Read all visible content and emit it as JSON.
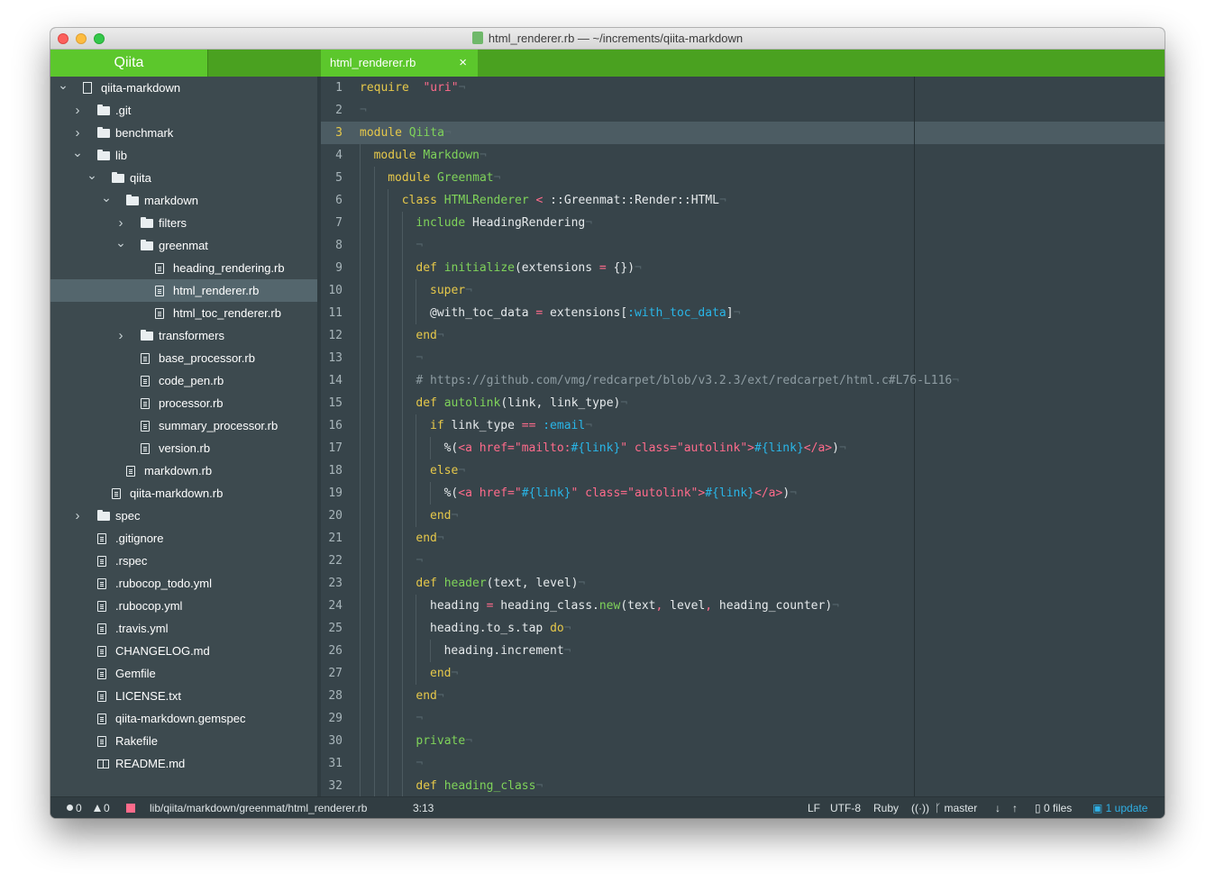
{
  "window": {
    "title": "html_renderer.rb — ~/increments/qiita-markdown"
  },
  "header": {
    "project_title": "Qiita",
    "active_tab": "html_renderer.rb",
    "tab_close": "×"
  },
  "sidebar": {
    "items": [
      {
        "label": "qiita-markdown",
        "type": "repo",
        "depth": 0,
        "chevron": "down"
      },
      {
        "label": ".git",
        "type": "folder",
        "depth": 1,
        "chevron": "right"
      },
      {
        "label": "benchmark",
        "type": "folder",
        "depth": 1,
        "chevron": "right"
      },
      {
        "label": "lib",
        "type": "folder",
        "depth": 1,
        "chevron": "down"
      },
      {
        "label": "qiita",
        "type": "folder",
        "depth": 2,
        "chevron": "down"
      },
      {
        "label": "markdown",
        "type": "folder",
        "depth": 3,
        "chevron": "down"
      },
      {
        "label": "filters",
        "type": "folder",
        "depth": 4,
        "chevron": "right"
      },
      {
        "label": "greenmat",
        "type": "folder",
        "depth": 4,
        "chevron": "down"
      },
      {
        "label": "heading_rendering.rb",
        "type": "file",
        "depth": 5,
        "chevron": ""
      },
      {
        "label": "html_renderer.rb",
        "type": "file",
        "depth": 5,
        "chevron": "",
        "selected": true
      },
      {
        "label": "html_toc_renderer.rb",
        "type": "file",
        "depth": 5,
        "chevron": ""
      },
      {
        "label": "transformers",
        "type": "folder",
        "depth": 4,
        "chevron": "right"
      },
      {
        "label": "base_processor.rb",
        "type": "file",
        "depth": 4,
        "chevron": ""
      },
      {
        "label": "code_pen.rb",
        "type": "file",
        "depth": 4,
        "chevron": ""
      },
      {
        "label": "processor.rb",
        "type": "file",
        "depth": 4,
        "chevron": ""
      },
      {
        "label": "summary_processor.rb",
        "type": "file",
        "depth": 4,
        "chevron": ""
      },
      {
        "label": "version.rb",
        "type": "file",
        "depth": 4,
        "chevron": ""
      },
      {
        "label": "markdown.rb",
        "type": "file",
        "depth": 3,
        "chevron": ""
      },
      {
        "label": "qiita-markdown.rb",
        "type": "file",
        "depth": 2,
        "chevron": ""
      },
      {
        "label": "spec",
        "type": "folder",
        "depth": 1,
        "chevron": "right"
      },
      {
        "label": ".gitignore",
        "type": "file",
        "depth": 1,
        "chevron": ""
      },
      {
        "label": ".rspec",
        "type": "file",
        "depth": 1,
        "chevron": ""
      },
      {
        "label": ".rubocop_todo.yml",
        "type": "file",
        "depth": 1,
        "chevron": ""
      },
      {
        "label": ".rubocop.yml",
        "type": "file",
        "depth": 1,
        "chevron": ""
      },
      {
        "label": ".travis.yml",
        "type": "file",
        "depth": 1,
        "chevron": ""
      },
      {
        "label": "CHANGELOG.md",
        "type": "file",
        "depth": 1,
        "chevron": ""
      },
      {
        "label": "Gemfile",
        "type": "file",
        "depth": 1,
        "chevron": ""
      },
      {
        "label": "LICENSE.txt",
        "type": "file",
        "depth": 1,
        "chevron": ""
      },
      {
        "label": "qiita-markdown.gemspec",
        "type": "file",
        "depth": 1,
        "chevron": ""
      },
      {
        "label": "Rakefile",
        "type": "file",
        "depth": 1,
        "chevron": ""
      },
      {
        "label": "README.md",
        "type": "book",
        "depth": 1,
        "chevron": ""
      }
    ]
  },
  "editor": {
    "cursor_line": 3,
    "lines": [
      {
        "n": "1",
        "indent": 0,
        "tokens": [
          [
            "kw",
            "require"
          ],
          [
            "",
            "  "
          ],
          [
            "str",
            "\"uri\""
          ]
        ]
      },
      {
        "n": "2",
        "indent": 0,
        "tokens": []
      },
      {
        "n": "3",
        "indent": 0,
        "tokens": [
          [
            "kw",
            "module"
          ],
          [
            "",
            " "
          ],
          [
            "cls",
            "Qiita"
          ]
        ]
      },
      {
        "n": "4",
        "indent": 1,
        "tokens": [
          [
            "kw",
            "module"
          ],
          [
            "",
            " "
          ],
          [
            "cls",
            "Markdown"
          ]
        ]
      },
      {
        "n": "5",
        "indent": 2,
        "tokens": [
          [
            "kw",
            "module"
          ],
          [
            "",
            " "
          ],
          [
            "cls",
            "Greenmat"
          ]
        ]
      },
      {
        "n": "6",
        "indent": 3,
        "tokens": [
          [
            "kw",
            "class"
          ],
          [
            "",
            " "
          ],
          [
            "cls",
            "HTMLRenderer"
          ],
          [
            "",
            " "
          ],
          [
            "op",
            "<"
          ],
          [
            "",
            " ::Greenmat::Render::HTML"
          ]
        ]
      },
      {
        "n": "7",
        "indent": 4,
        "tokens": [
          [
            "fn",
            "include"
          ],
          [
            "",
            " HeadingRendering"
          ]
        ]
      },
      {
        "n": "8",
        "indent": 4,
        "tokens": []
      },
      {
        "n": "9",
        "indent": 4,
        "tokens": [
          [
            "kw",
            "def"
          ],
          [
            "",
            " "
          ],
          [
            "fn",
            "initialize"
          ],
          [
            "",
            "(extensions "
          ],
          [
            "op",
            "="
          ],
          [
            "",
            " {})"
          ]
        ]
      },
      {
        "n": "10",
        "indent": 5,
        "tokens": [
          [
            "kw",
            "super"
          ]
        ]
      },
      {
        "n": "11",
        "indent": 5,
        "tokens": [
          [
            "",
            "@with_toc_data "
          ],
          [
            "op",
            "="
          ],
          [
            "",
            " extensions["
          ],
          [
            "sym",
            ":with_toc_data"
          ],
          [
            "",
            "]"
          ]
        ]
      },
      {
        "n": "12",
        "indent": 4,
        "tokens": [
          [
            "kw",
            "end"
          ]
        ]
      },
      {
        "n": "13",
        "indent": 4,
        "tokens": []
      },
      {
        "n": "14",
        "indent": 4,
        "tokens": [
          [
            "cmt",
            "# https://github.com/vmg/redcarpet/blob/v3.2.3/ext/redcarpet/html.c#L76-L116"
          ]
        ]
      },
      {
        "n": "15",
        "indent": 4,
        "tokens": [
          [
            "kw",
            "def"
          ],
          [
            "",
            " "
          ],
          [
            "fn",
            "autolink"
          ],
          [
            "",
            "(link, link_type)"
          ]
        ]
      },
      {
        "n": "16",
        "indent": 5,
        "tokens": [
          [
            "kw",
            "if"
          ],
          [
            "",
            " link_type "
          ],
          [
            "op",
            "=="
          ],
          [
            "",
            " "
          ],
          [
            "sym",
            ":email"
          ]
        ]
      },
      {
        "n": "17",
        "indent": 6,
        "tokens": [
          [
            "",
            "%("
          ],
          [
            "str",
            "<a href=\"mailto:"
          ],
          [
            "sym",
            "#{link}"
          ],
          [
            "str",
            "\" class=\"autolink\">"
          ],
          [
            "sym",
            "#{link}"
          ],
          [
            "str",
            "</a>"
          ],
          [
            "",
            ")"
          ]
        ]
      },
      {
        "n": "18",
        "indent": 5,
        "tokens": [
          [
            "kw",
            "else"
          ]
        ]
      },
      {
        "n": "19",
        "indent": 6,
        "tokens": [
          [
            "",
            "%("
          ],
          [
            "str",
            "<a href=\""
          ],
          [
            "sym",
            "#{link}"
          ],
          [
            "str",
            "\" class=\"autolink\">"
          ],
          [
            "sym",
            "#{link}"
          ],
          [
            "str",
            "</a>"
          ],
          [
            "",
            ")"
          ]
        ]
      },
      {
        "n": "20",
        "indent": 5,
        "tokens": [
          [
            "kw",
            "end"
          ]
        ]
      },
      {
        "n": "21",
        "indent": 4,
        "tokens": [
          [
            "kw",
            "end"
          ]
        ]
      },
      {
        "n": "22",
        "indent": 4,
        "tokens": []
      },
      {
        "n": "23",
        "indent": 4,
        "tokens": [
          [
            "kw",
            "def"
          ],
          [
            "",
            " "
          ],
          [
            "fn",
            "header"
          ],
          [
            "",
            "(text, level)"
          ]
        ]
      },
      {
        "n": "24",
        "indent": 5,
        "tokens": [
          [
            "",
            "heading "
          ],
          [
            "op",
            "="
          ],
          [
            "",
            " heading_class."
          ],
          [
            "fn",
            "new"
          ],
          [
            "",
            "(text"
          ],
          [
            "op",
            ","
          ],
          [
            "",
            " level"
          ],
          [
            "op",
            ","
          ],
          [
            "",
            " heading_counter)"
          ]
        ]
      },
      {
        "n": "25",
        "indent": 5,
        "tokens": [
          [
            "",
            "heading.to_s.tap "
          ],
          [
            "kw",
            "do"
          ]
        ]
      },
      {
        "n": "26",
        "indent": 6,
        "tokens": [
          [
            "",
            "heading.increment"
          ]
        ]
      },
      {
        "n": "27",
        "indent": 5,
        "tokens": [
          [
            "kw",
            "end"
          ]
        ]
      },
      {
        "n": "28",
        "indent": 4,
        "tokens": [
          [
            "kw",
            "end"
          ]
        ]
      },
      {
        "n": "29",
        "indent": 4,
        "tokens": []
      },
      {
        "n": "30",
        "indent": 4,
        "tokens": [
          [
            "fn",
            "private"
          ]
        ]
      },
      {
        "n": "31",
        "indent": 4,
        "tokens": []
      },
      {
        "n": "32",
        "indent": 4,
        "tokens": [
          [
            "kw",
            "def"
          ],
          [
            "",
            " "
          ],
          [
            "fn",
            "heading_class"
          ]
        ]
      }
    ]
  },
  "statusbar": {
    "errors": "0",
    "warnings": "0",
    "path": "lib/qiita/markdown/greenmat/html_renderer.rb",
    "cursor": "3:13",
    "line_ending": "LF",
    "encoding": "UTF-8",
    "grammar": "Ruby",
    "branch": "master",
    "files": "0 files",
    "update": "1 update"
  }
}
